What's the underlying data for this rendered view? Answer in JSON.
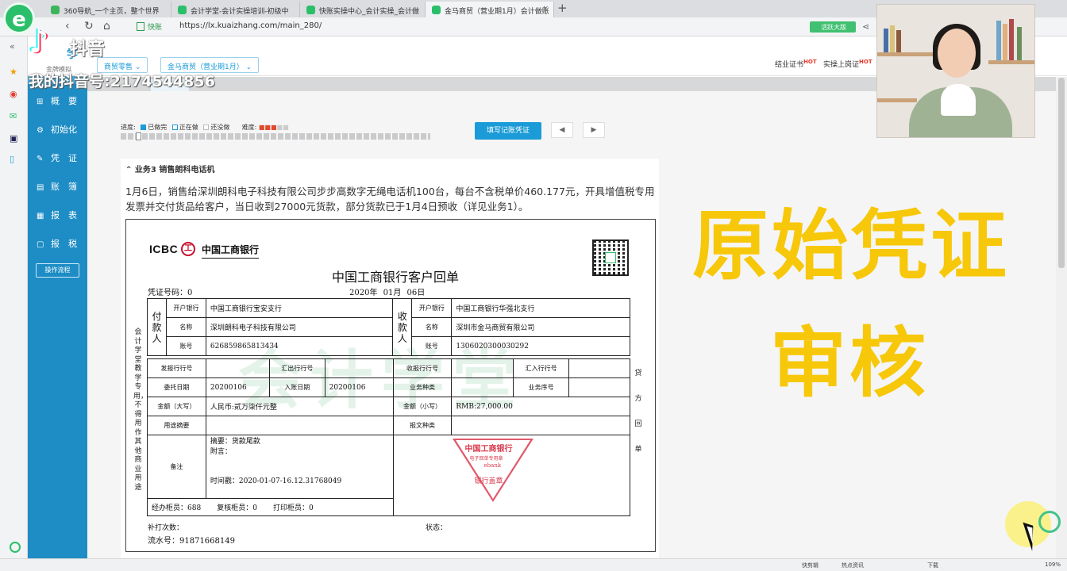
{
  "browser": {
    "tabs": [
      {
        "label": "360导航_一个主页，整个世界",
        "color": "#3cb55c"
      },
      {
        "label": "会计学堂-会计实操培训-初级中",
        "color": "#2bbf6b"
      },
      {
        "label": "快账实操中心_会计实操_会计做",
        "color": "#2bbf6b"
      },
      {
        "label": "金马商贸（营业期1月）会计做账",
        "color": "#2bbf6b"
      }
    ],
    "new_tab": "+",
    "close": "×",
    "safe_label": "快账",
    "url": "https://lx.kuaizhang.com/main_280/",
    "green_button": "活跃大版"
  },
  "browser_sidebar": {
    "icons": [
      "back-icon",
      "star-icon",
      "weibo-icon",
      "mail-icon",
      "app-icon",
      "doc-icon"
    ]
  },
  "app": {
    "brand": "学",
    "brand_sub": "金牌模拟",
    "dropdowns": [
      "商贸零售 ⌄",
      "金马商贸（营业期1月） ⌄"
    ],
    "header_links": [
      {
        "label": "结业证书",
        "hot": "HOT"
      },
      {
        "label": "实操上岗证",
        "hot": "HOT"
      }
    ]
  },
  "sidebar": {
    "items": [
      {
        "label": "概　要",
        "icon": "⊞"
      },
      {
        "label": "初始化",
        "icon": "⚙"
      },
      {
        "label": "凭　证",
        "icon": "✎"
      },
      {
        "label": "账　簿",
        "icon": "▤"
      },
      {
        "label": "报　表",
        "icon": "▦"
      },
      {
        "label": "报　税",
        "icon": "▢"
      }
    ],
    "process_button": "操作流程"
  },
  "progress": {
    "label": "进度:",
    "legend": [
      "已做完",
      "正在做",
      "还没做"
    ],
    "difficulty_label": "难度:",
    "difficulty": 3,
    "difficulty_max": 5,
    "fill_button": "填写记账凭证",
    "prev": "◀",
    "next": "▶"
  },
  "task": {
    "title": "业务3 销售朗科电话机",
    "description": "1月6日，销售给深圳朗科电子科技有限公司步步高数字无绳电话机100台，每台不含税单价460.177元，开具增值税专用发票并交付货品给客户，当日收到27000元货款，部分货款已于1月4日预收（详见业务1）。"
  },
  "voucher": {
    "logo": "ICBC",
    "logo_mark": "工",
    "bank_name": "中国工商银行",
    "title": "中国工商银行客户回单",
    "voucher_no": "凭证号码：0",
    "date": "2020年 01月 06日",
    "side_text": "会计学堂教学专用，不得用作其他商业用途",
    "right_text": "贷方回单",
    "payer_label": "付款人",
    "payee_label": "收款人",
    "open_bank_label": "开户银行",
    "name_label": "名称",
    "account_label": "账号",
    "payer_bank": "中国工商银行宝安支行",
    "payer_name": "深圳朗科电子科技有限公司",
    "payer_account": "626859865813434",
    "payee_bank": "中国工商银行华强北支行",
    "payee_name": "深圳市金马商贸有限公司",
    "payee_account": "1306020300030292",
    "row_labels": {
      "send_bank": "发报行行号",
      "out_bank": "汇出行行号",
      "recv_bank": "收报行行号",
      "in_bank": "汇入行行号",
      "commission_date": "委托日期",
      "entry_date": "入账日期",
      "biz_type": "业务种类",
      "biz_no": "业务序号",
      "amount_upper": "金额（大写）",
      "amount_lower": "金额（小写）",
      "purpose": "用途摘要",
      "message_type": "报文种类",
      "remark": "备注"
    },
    "commission_date": "20200106",
    "entry_date": "20200106",
    "amount_upper": "人民币:贰万柒仟元整",
    "amount_lower": "RMB:27,000.00",
    "summary": "摘要：货款尾款",
    "postscript": "附言：",
    "timestamp": "时间戳：2020-01-07-16.12.31768049",
    "handler": "经办柜员：688",
    "reviewer": "复核柜员：0",
    "printer": "打印柜员：0",
    "reprint": "补打次数：",
    "status": "状态：",
    "serial": "流水号：91871668149",
    "stamp": {
      "line1": "中国工商银行",
      "line2": "电子回单专用章",
      "line3": "ebank",
      "line4": "银行盖章"
    },
    "watermark": "会计学堂"
  },
  "overlay": {
    "line1": "原始凭证",
    "line2": "审核",
    "tiktok_name": "抖音",
    "tiktok_id": "我的抖音号:2174544856"
  },
  "statusbar": {
    "items": [
      "快剪辑",
      "热点资讯",
      "下载",
      "109%"
    ]
  }
}
